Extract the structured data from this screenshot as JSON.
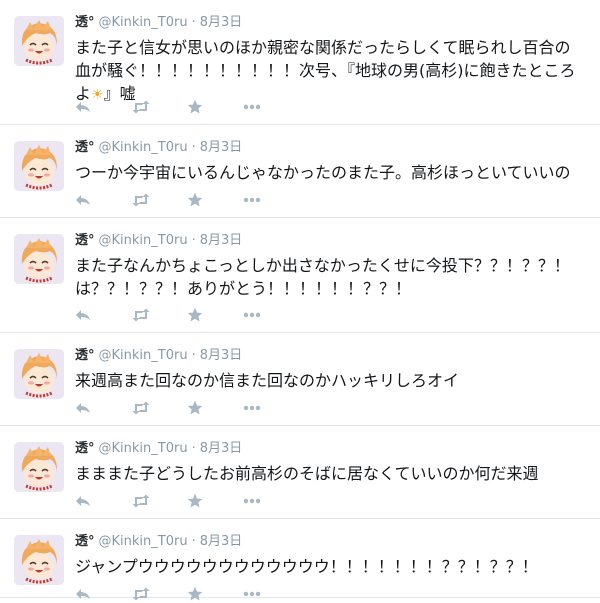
{
  "tweets": [
    {
      "name": "透°",
      "handle": "@Kinkin_T0ru",
      "separator": "·",
      "date": "8月3日",
      "text_lines": [
        "また子と信女が思いのほか親密な関係だったらしくて眠られし百合の",
        "血が騒ぐ！！！！！！！！！！次号、『地球の男(高杉)に飽きたところ"
      ],
      "text_tail": "よ",
      "emoji": "☀",
      "text_end": "』嘘"
    },
    {
      "name": "透°",
      "handle": "@Kinkin_T0ru",
      "separator": "·",
      "date": "8月3日",
      "text_lines": [
        "つーか今宇宙にいるんじゃなかったのまた子。高杉ほっといていいの"
      ]
    },
    {
      "name": "透°",
      "handle": "@Kinkin_T0ru",
      "separator": "·",
      "date": "8月3日",
      "text_lines": [
        "また子なんかちょこっとしか出さなかったくせに今投下？？！？？！",
        "は？？！？？！ありがとう！！！！！！？？！"
      ]
    },
    {
      "name": "透°",
      "handle": "@Kinkin_T0ru",
      "separator": "·",
      "date": "8月3日",
      "text_lines": [
        "来週高また回なのか信また回なのかハッキリしろオイ"
      ]
    },
    {
      "name": "透°",
      "handle": "@Kinkin_T0ru",
      "separator": "·",
      "date": "8月3日",
      "text_lines": [
        "まままた子どうしたお前高杉のそばに居なくていいのか何だ来週"
      ]
    },
    {
      "name": "透°",
      "handle": "@Kinkin_T0ru",
      "separator": "·",
      "date": "8月3日",
      "text_lines": [
        "ジャンプウウウウウウウウウウウウ！！！！！！！？？！？？！"
      ]
    }
  ],
  "icons": {
    "reply": "reply-icon",
    "retweet": "retweet-icon",
    "favorite": "star-icon",
    "more": "more-icon"
  },
  "colors": {
    "text": "#14171a",
    "meta": "#8899a6",
    "action_icon": "#a8b8c4",
    "divider": "#e1e8ed",
    "avatar_bg": "#ece6f2"
  }
}
